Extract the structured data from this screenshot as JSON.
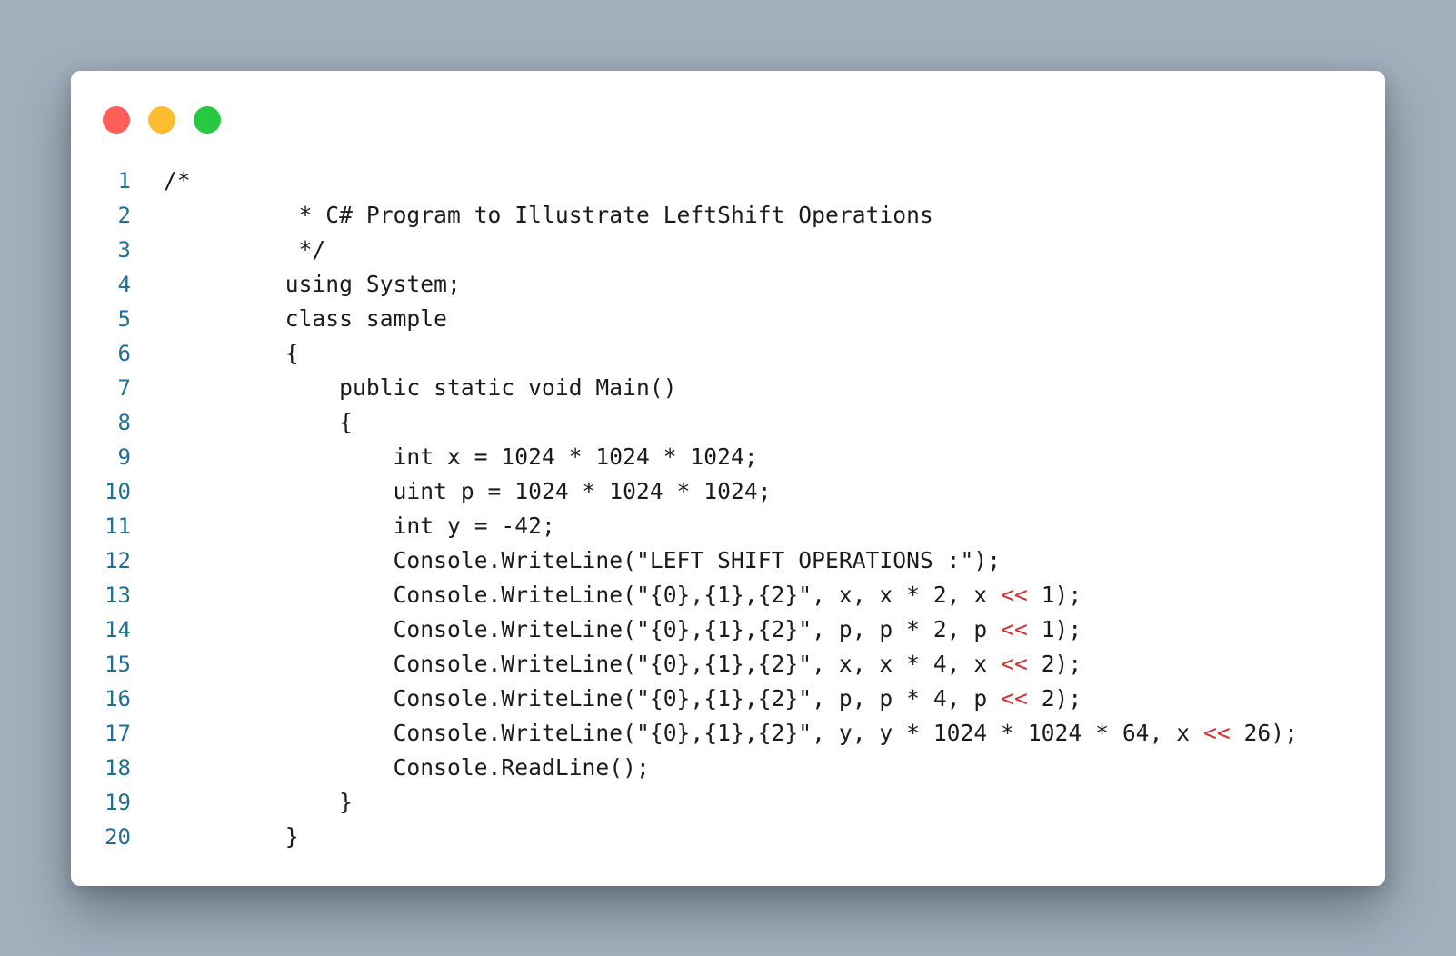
{
  "window": {
    "controls": [
      {
        "name": "close",
        "color": "#ff5f57"
      },
      {
        "name": "minimize",
        "color": "#febc2e"
      },
      {
        "name": "maximize",
        "color": "#28c840"
      }
    ]
  },
  "colors": {
    "line_number": "#1f6f95",
    "code_text": "#1b1b1b",
    "operator": "#d32f2f",
    "background": "#a3afbd"
  },
  "code": {
    "language": "C#",
    "lines": [
      {
        "n": "1",
        "parts": [
          {
            "t": "/*"
          }
        ]
      },
      {
        "n": "2",
        "parts": [
          {
            "t": "          * C# Program to Illustrate LeftShift Operations"
          }
        ]
      },
      {
        "n": "3",
        "parts": [
          {
            "t": "          */"
          }
        ]
      },
      {
        "n": "4",
        "parts": [
          {
            "t": "         using System;"
          }
        ]
      },
      {
        "n": "5",
        "parts": [
          {
            "t": "         class sample"
          }
        ]
      },
      {
        "n": "6",
        "parts": [
          {
            "t": "         {"
          }
        ]
      },
      {
        "n": "7",
        "parts": [
          {
            "t": "             public static void Main()"
          }
        ]
      },
      {
        "n": "8",
        "parts": [
          {
            "t": "             {"
          }
        ]
      },
      {
        "n": "9",
        "parts": [
          {
            "t": "                 int x = 1024 * 1024 * 1024;"
          }
        ]
      },
      {
        "n": "10",
        "parts": [
          {
            "t": "                 uint p = 1024 * 1024 * 1024;"
          }
        ]
      },
      {
        "n": "11",
        "parts": [
          {
            "t": "                 int y = -42;"
          }
        ]
      },
      {
        "n": "12",
        "parts": [
          {
            "t": "                 Console.WriteLine(\"LEFT SHIFT OPERATIONS :\");"
          }
        ]
      },
      {
        "n": "13",
        "parts": [
          {
            "t": "                 Console.WriteLine(\"{0},{1},{2}\", x, x * 2, x "
          },
          {
            "t": "<<",
            "op": true
          },
          {
            "t": " 1);"
          }
        ]
      },
      {
        "n": "14",
        "parts": [
          {
            "t": "                 Console.WriteLine(\"{0},{1},{2}\", p, p * 2, p "
          },
          {
            "t": "<<",
            "op": true
          },
          {
            "t": " 1);"
          }
        ]
      },
      {
        "n": "15",
        "parts": [
          {
            "t": "                 Console.WriteLine(\"{0},{1},{2}\", x, x * 4, x "
          },
          {
            "t": "<<",
            "op": true
          },
          {
            "t": " 2);"
          }
        ]
      },
      {
        "n": "16",
        "parts": [
          {
            "t": "                 Console.WriteLine(\"{0},{1},{2}\", p, p * 4, p "
          },
          {
            "t": "<<",
            "op": true
          },
          {
            "t": " 2);"
          }
        ]
      },
      {
        "n": "17",
        "parts": [
          {
            "t": "                 Console.WriteLine(\"{0},{1},{2}\", y, y * 1024 * 1024 * 64, x "
          },
          {
            "t": "<<",
            "op": true
          },
          {
            "t": " 26);"
          }
        ]
      },
      {
        "n": "18",
        "parts": [
          {
            "t": "                 Console.ReadLine();"
          }
        ]
      },
      {
        "n": "19",
        "parts": [
          {
            "t": "             }"
          }
        ]
      },
      {
        "n": "20",
        "parts": [
          {
            "t": "         }"
          }
        ]
      }
    ]
  }
}
